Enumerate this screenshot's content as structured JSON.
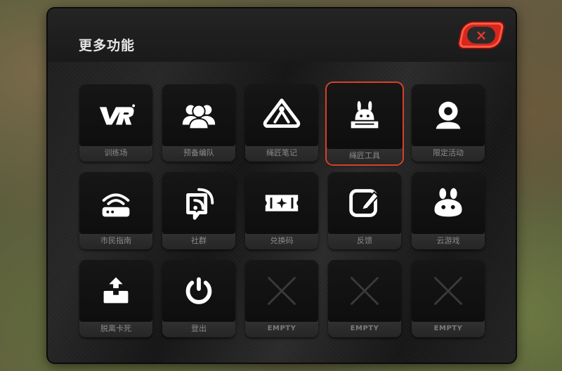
{
  "panel": {
    "title": "更多功能",
    "close_icon": "×"
  },
  "colors": {
    "accent_red": "#d8271c",
    "tile_bg": "#0e0e0e",
    "label_text": "#8a8a8a"
  },
  "tiles": [
    {
      "label": "训练场",
      "icon": "vr-icon"
    },
    {
      "label": "预备编队",
      "icon": "team-icon"
    },
    {
      "label": "绳匠笔记",
      "icon": "compass-icon"
    },
    {
      "label": "绳匠工具",
      "icon": "bunny-tool-icon",
      "selected": true
    },
    {
      "label": "限定活动",
      "icon": "webcam-icon"
    },
    {
      "label": "市民指南",
      "icon": "router-icon"
    },
    {
      "label": "社群",
      "icon": "community-icon"
    },
    {
      "label": "兑换码",
      "icon": "ticket-icon"
    },
    {
      "label": "反馈",
      "icon": "edit-icon"
    },
    {
      "label": "云游戏",
      "icon": "cloud-game-icon"
    },
    {
      "label": "脱离卡死",
      "icon": "unstuck-icon"
    },
    {
      "label": "登出",
      "icon": "power-icon"
    },
    {
      "label": "EMPTY",
      "icon": "empty-x-icon"
    },
    {
      "label": "EMPTY",
      "icon": "empty-x-icon"
    },
    {
      "label": "EMPTY",
      "icon": "empty-x-icon"
    }
  ]
}
